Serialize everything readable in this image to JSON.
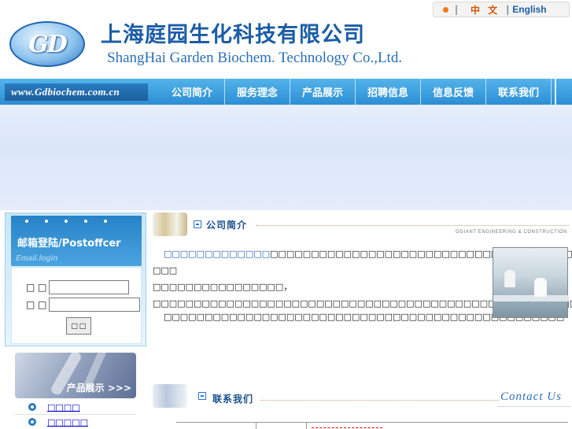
{
  "header": {
    "logo_text": "GD",
    "company_cn": "上海庭园生化科技有限公司",
    "company_en": "ShangHai Garden Biochem. Technology Co.,Ltd.",
    "lang": {
      "sep": "|",
      "cn": "中 文",
      "en": "English"
    }
  },
  "nav": {
    "url": "www.Gdbiochem.com.cn",
    "items": [
      "公司简介",
      "服务理念",
      "产品展示",
      "招聘信息",
      "信息反馈",
      "联系我们"
    ]
  },
  "sidebar": {
    "login_title": "邮箱登陆/Postoffcer",
    "login_sub": "Email.login",
    "user_label": "□ □",
    "pass_label": "□ □",
    "submit_label": "□ □",
    "product_label": "产品展示 >>>",
    "links": [
      "□□□□",
      "□□□□□"
    ]
  },
  "main": {
    "about_title": "公司简介",
    "about_sub": "OGIANT ENGINEERING & CONSTRUCTION",
    "about_highlight": "□□□□□□□□□□□□□",
    "about_line1": "□□□□□□□□□□□□□□□□□□□□□□□□□□□□□□□□□□□□□□□□□□□□□□□□□□ □□□",
    "about_line2": "□□□□□□□□□□□□□□□□，□□□□□□□□□□□□□□□□□□□□□□□□□□□□□□□□□□□□□□□□□□□□□□□□□□□□□□□□□□□□□□□□□□□□□□□□□□□□□□□□□□□□□□□□□□□□□□□□□□□□□□□□",
    "about_line3": "□□□□□□□□□□□□□□□□□□□□□□□□□□□□□□□□□□□□□□□□□□□□□□□□□",
    "contact_title": "联系我们",
    "contact_en": "Contact Us"
  }
}
